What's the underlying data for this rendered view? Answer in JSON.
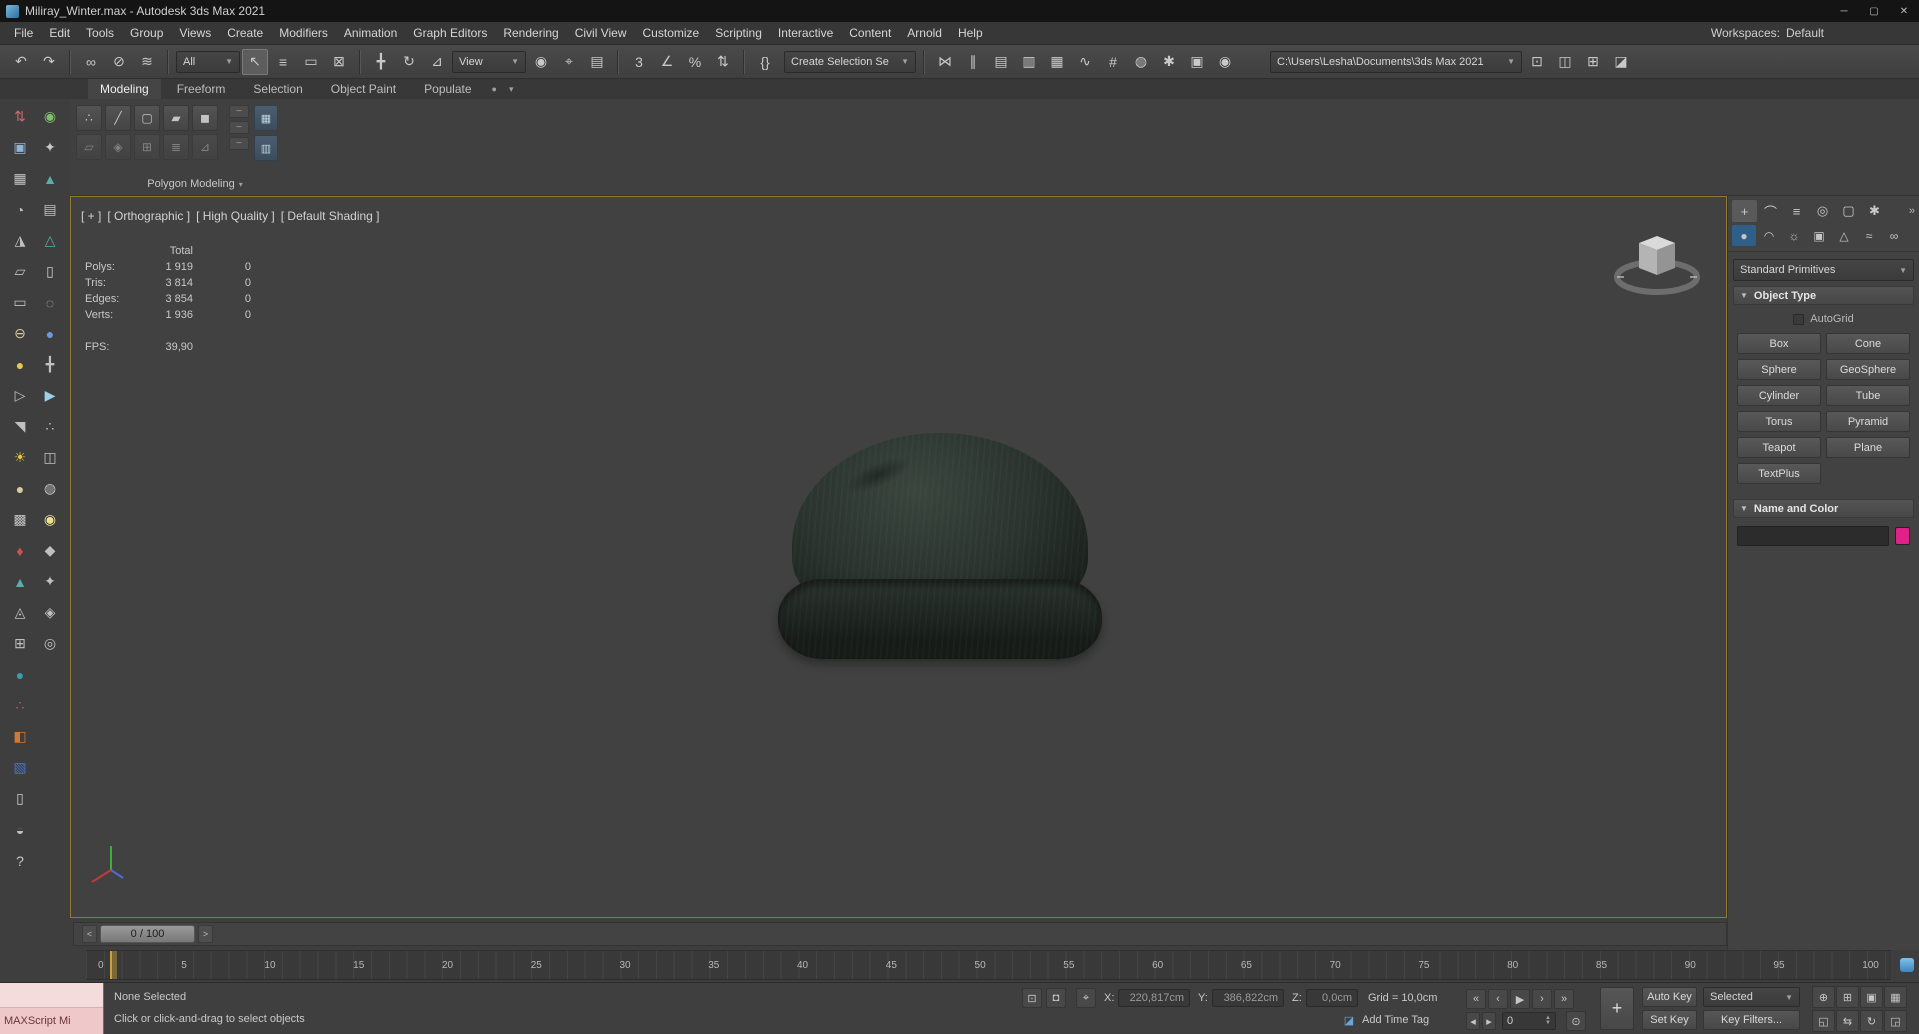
{
  "window": {
    "title": "Miliray_Winter.max - Autodesk 3ds Max 2021",
    "minimize_glyph": "─",
    "maximize_glyph": "▢",
    "close_glyph": "✕",
    "workspaces_label": "Workspaces:",
    "workspace_value": "Default"
  },
  "menu": {
    "items": [
      "File",
      "Edit",
      "Tools",
      "Group",
      "Views",
      "Create",
      "Modifiers",
      "Animation",
      "Graph Editors",
      "Rendering",
      "Civil View",
      "Customize",
      "Scripting",
      "Interactive",
      "Content",
      "Arnold",
      "Help"
    ]
  },
  "toolbar": {
    "group1": [
      {
        "n": "undo-button",
        "g": "↶"
      },
      {
        "n": "redo-button",
        "g": "↷"
      }
    ],
    "group2": [
      {
        "n": "select-and-link-button",
        "g": "∞"
      },
      {
        "n": "unlink-selection-button",
        "g": "⊘"
      },
      {
        "n": "bind-to-space-warp-button",
        "g": "≋"
      }
    ],
    "selection_filter": "All",
    "group3": [
      {
        "n": "select-object-button",
        "g": "↖",
        "active": true
      },
      {
        "n": "select-by-name-button",
        "g": "≡"
      },
      {
        "n": "rectangular-selection-region-button",
        "g": "▭"
      },
      {
        "n": "window-crossing-toggle",
        "g": "⊠"
      }
    ],
    "group4": [
      {
        "n": "select-and-move-button",
        "g": "╋"
      },
      {
        "n": "select-and-rotate-button",
        "g": "↻"
      },
      {
        "n": "select-and-scale-button",
        "g": "⊿"
      }
    ],
    "ref_coord": "View",
    "group5": [
      {
        "n": "use-pivot-point-center-button",
        "g": "◉"
      },
      {
        "n": "select-and-manipulate-button",
        "g": "⌖"
      },
      {
        "n": "keyboard-shortcut-override-toggle",
        "g": "▤"
      }
    ],
    "group6": [
      {
        "n": "snaps-toggle",
        "g": "3"
      },
      {
        "n": "angle-snap-toggle",
        "g": "∠"
      },
      {
        "n": "percent-snap-toggle",
        "g": "%"
      },
      {
        "n": "spinner-snap-toggle",
        "g": "⇅"
      }
    ],
    "group7": [
      {
        "n": "edit-named-selection-sets-button",
        "g": "{}"
      }
    ],
    "named_sets": "Create Selection Se",
    "group8": [
      {
        "n": "mirror-button",
        "g": "⋈"
      },
      {
        "n": "align-button",
        "g": "∥"
      },
      {
        "n": "toggle-scene-explorer-button",
        "g": "▤"
      },
      {
        "n": "toggle-layer-explorer-button",
        "g": "▥"
      },
      {
        "n": "toggle-ribbon-button",
        "g": "▦"
      },
      {
        "n": "curve-editor-button",
        "g": "∿"
      },
      {
        "n": "schematic-view-button",
        "g": "#"
      },
      {
        "n": "material-editor-button",
        "g": "◍"
      },
      {
        "n": "render-setup-button",
        "g": "✱"
      },
      {
        "n": "rendered-frame-window-button",
        "g": "▣"
      },
      {
        "n": "render-production-button",
        "g": "◉"
      }
    ],
    "project_path": "C:\\Users\\Lesha\\Documents\\3ds Max 2021",
    "group9": [
      {
        "n": "toolbar-button",
        "g": "⊡"
      },
      {
        "n": "toolbar-button",
        "g": "◫"
      },
      {
        "n": "toolbar-button",
        "g": "⊞"
      },
      {
        "n": "toolbar-button",
        "g": "◪"
      }
    ]
  },
  "ribbon": {
    "tabs": [
      {
        "label": "Modeling",
        "active": true
      },
      {
        "label": "Freeform"
      },
      {
        "label": "Selection"
      },
      {
        "label": "Object Paint"
      },
      {
        "label": "Populate"
      }
    ],
    "tab_extra_circle": "●",
    "tab_extra_caret": "▾",
    "small_buttons_row1": [
      {
        "n": "vertex-mode-button",
        "g": "∴"
      },
      {
        "n": "edge-mode-button",
        "g": "╱"
      },
      {
        "n": "border-mode-button",
        "g": "▢"
      },
      {
        "n": "polygon-mode-button",
        "g": "▰"
      },
      {
        "n": "element-mode-button",
        "g": "◼"
      }
    ],
    "small_buttons_row2": [
      {
        "n": "ribbon-small-button",
        "g": "▱"
      },
      {
        "n": "ribbon-small-button",
        "g": "◈"
      },
      {
        "n": "ribbon-small-button",
        "g": "⊞"
      },
      {
        "n": "ribbon-small-button",
        "g": "≣"
      },
      {
        "n": "ribbon-small-button",
        "g": "⊿"
      }
    ],
    "side_tiny": [
      {
        "g": "─"
      },
      {
        "g": "─"
      },
      {
        "g": "─"
      }
    ],
    "side_tall": [
      {
        "g": "▦"
      },
      {
        "g": "▥"
      }
    ],
    "section_label": "Polygon Modeling",
    "section_caret": "▾"
  },
  "left_dock": {
    "tools": [
      {
        "g": "⇅",
        "c": "#c96a6a"
      },
      {
        "g": "◉",
        "c": "#7fbf6a"
      },
      {
        "g": "▣",
        "c": "#8fb3d9"
      },
      {
        "g": "✦",
        "c": "#c9c9c9"
      },
      {
        "g": "▦",
        "c": "#c0c0c0"
      },
      {
        "g": "▲",
        "c": "#55b0a8"
      },
      {
        "g": "◔",
        "c": "#c0c0c0"
      },
      {
        "g": "▤",
        "c": "#c0c0c0"
      },
      {
        "g": "◮",
        "c": "#c0c0c0"
      },
      {
        "g": "△",
        "c": "#55b0a8"
      },
      {
        "g": "▱",
        "c": "#c0c0c0"
      },
      {
        "g": "▯",
        "c": "#c9c9c9"
      },
      {
        "g": "▭",
        "c": "#c0c0c0"
      },
      {
        "g": "◌",
        "c": "#c0c0c0"
      },
      {
        "g": "⊖",
        "c": "#d8c9a3"
      },
      {
        "g": "●",
        "c": "#6a9bd8"
      },
      {
        "g": "●",
        "c": "#e3c94e"
      },
      {
        "g": "╋",
        "c": "#c0c0c0"
      },
      {
        "g": "▷",
        "c": "#c0c0c0"
      },
      {
        "g": "▶",
        "c": "#9ad0e8"
      },
      {
        "g": "◥",
        "c": "#c0c0c0"
      },
      {
        "g": "∴",
        "c": "#c0c0c0"
      },
      {
        "g": "☀",
        "c": "#e8c542"
      },
      {
        "g": "◫",
        "c": "#c0c0c0"
      },
      {
        "g": "●",
        "c": "#d8c9a3"
      },
      {
        "g": "◍",
        "c": "#c0c0c0"
      },
      {
        "g": "▩",
        "c": "#c0c0c0"
      },
      {
        "g": "◉",
        "c": "#e8e08a"
      },
      {
        "g": "♦",
        "c": "#d05050"
      },
      {
        "g": "◆",
        "c": "#c0c0c0"
      },
      {
        "g": "▲",
        "c": "#55b0a8"
      },
      {
        "g": "✦",
        "c": "#c0c0c0"
      },
      {
        "g": "◬",
        "c": "#c0c0c0"
      },
      {
        "g": "◈",
        "c": "#c0c0c0"
      },
      {
        "g": "⊞",
        "c": "#c0c0c0"
      },
      {
        "g": "◎",
        "c": "#c0c0c0"
      }
    ],
    "tools_bottom": [
      {
        "g": "●",
        "c": "#3d9bb0"
      },
      {
        "g": "∴",
        "c": "#d05050"
      },
      {
        "g": "◧",
        "c": "#d07a35"
      },
      {
        "g": "▧",
        "c": "#4a6fd0"
      },
      {
        "g": "▯",
        "c": "#c9c9c9"
      },
      {
        "g": "◒",
        "c": "#c0c0c0"
      },
      {
        "g": "?",
        "c": "#c9c9c9"
      }
    ]
  },
  "viewport": {
    "label_segments": [
      "[ + ]",
      "[ Orthographic ]",
      "[ High Quality ]",
      "[ Default Shading ]"
    ],
    "stats": {
      "total_header": "Total",
      "rows": [
        {
          "label": "Polys:",
          "total": "1 919",
          "sel": "0"
        },
        {
          "label": "Tris:",
          "total": "3 814",
          "sel": "0"
        },
        {
          "label": "Edges:",
          "total": "3 854",
          "sel": "0"
        },
        {
          "label": "Verts:",
          "total": "1 936",
          "sel": "0"
        }
      ],
      "fps_label": "FPS:",
      "fps_value": "39,90"
    },
    "model_color_light": "#39453d",
    "model_color_mid": "#2a332e",
    "model_color_dark": "#161b17"
  },
  "command_panel": {
    "tabs": [
      {
        "n": "create-tab",
        "g": "+",
        "active": true
      },
      {
        "n": "modify-tab",
        "g": "⌒"
      },
      {
        "n": "hierarchy-tab",
        "g": "≡"
      },
      {
        "n": "motion-tab",
        "g": "◎"
      },
      {
        "n": "display-tab",
        "g": "▢"
      },
      {
        "n": "utilities-tab",
        "g": "✱"
      }
    ],
    "overflow": "»",
    "subtabs": [
      {
        "n": "geometry-category",
        "g": "●",
        "active": true
      },
      {
        "n": "shapes-category",
        "g": "◠"
      },
      {
        "n": "lights-category",
        "g": "☼"
      },
      {
        "n": "cameras-category",
        "g": "▣"
      },
      {
        "n": "helpers-category",
        "g": "△"
      },
      {
        "n": "space-warps-category",
        "g": "≈"
      },
      {
        "n": "systems-category",
        "g": "∞"
      }
    ],
    "category_dropdown": "Standard Primitives",
    "object_type": {
      "title": "Object Type",
      "autogrid_label": "AutoGrid",
      "buttons": [
        "Box",
        "Cone",
        "Sphere",
        "GeoSphere",
        "Cylinder",
        "Tube",
        "Torus",
        "Pyramid",
        "Teapot",
        "Plane",
        "TextPlus"
      ]
    },
    "name_color": {
      "title": "Name and Color",
      "swatch_color": "#e0218a"
    }
  },
  "timeline": {
    "slider_label": "0 / 100",
    "prev_arrow": "<",
    "next_arrow": ">",
    "ticks": [
      "0",
      "5",
      "10",
      "15",
      "20",
      "25",
      "30",
      "35",
      "40",
      "45",
      "50",
      "55",
      "60",
      "65",
      "70",
      "75",
      "80",
      "85",
      "90",
      "95",
      "100"
    ]
  },
  "status_bar": {
    "maxscript_label": "MAXScript Mi",
    "selection_status": "None Selected",
    "prompt": "Click or click-and-drag to select objects",
    "isolate_glyph": "⊡",
    "lock_glyph": "◘",
    "absolute_mode_glyph": "⌖",
    "coords": {
      "x_label": "X:",
      "x_value": "220,817cm",
      "y_label": "Y:",
      "y_value": "386,822cm",
      "z_label": "Z:",
      "z_value": "0,0cm"
    },
    "grid_label": "Grid = 10,0cm",
    "add_time_tag": "Add Time Tag",
    "tag_icon_glyph": "◪",
    "playback": [
      {
        "n": "go-to-start-button",
        "g": "«"
      },
      {
        "n": "previous-frame-button",
        "g": "‹"
      },
      {
        "n": "play-button",
        "g": "▶"
      },
      {
        "n": "next-frame-button",
        "g": "›"
      },
      {
        "n": "go-to-end-button",
        "g": "»"
      }
    ],
    "key_step_back": "◂",
    "key_step_fwd": "▸",
    "key_mode_glyph": "⊙",
    "time_config_plus": "+",
    "auto_key": "Auto Key",
    "set_key": "Set Key",
    "selected_dropdown": "Selected",
    "key_filters": "Key Filters...",
    "frame_value": "0",
    "nav_row1": [
      {
        "n": "zoom-button",
        "g": "⊕"
      },
      {
        "n": "zoom-all-button",
        "g": "⊞"
      },
      {
        "n": "zoom-extents-button",
        "g": "▣"
      },
      {
        "n": "zoom-extents-all-button",
        "g": "▦"
      }
    ],
    "nav_row2": [
      {
        "n": "zoom-region-button",
        "g": "◱"
      },
      {
        "n": "pan-button",
        "g": "⇆"
      },
      {
        "n": "orbit-button",
        "g": "↻"
      },
      {
        "n": "maximize-viewport-toggle",
        "g": "◲"
      }
    ]
  }
}
